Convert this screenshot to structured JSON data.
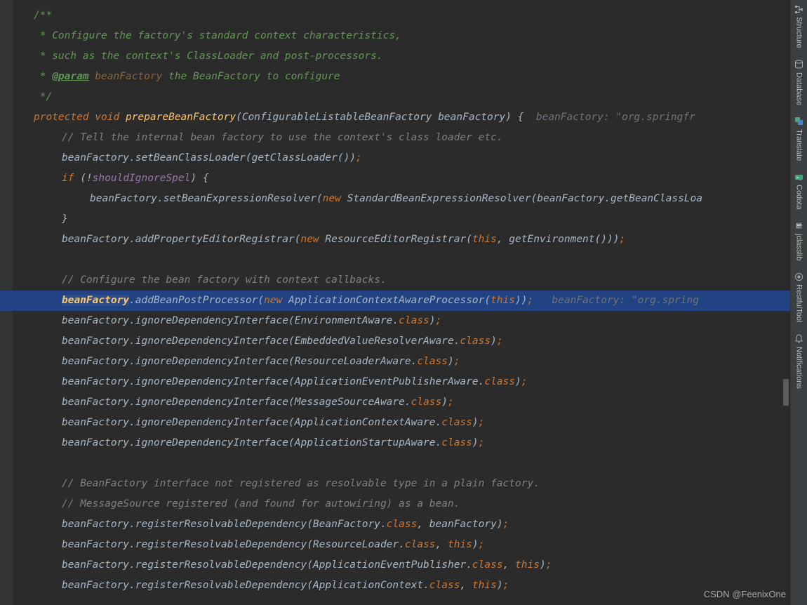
{
  "code": {
    "javadoc": {
      "l1": "/**",
      "l2": " * Configure the factory's standard context characteristics,",
      "l3": " * such as the context's ClassLoader and post-processors.",
      "l4_prefix": " * ",
      "l4_tag": "@param",
      "l4_param": " beanFactory",
      "l4_desc": " the BeanFactory to configure",
      "l5": " */"
    },
    "sig": {
      "protected": "protected",
      "void": " void ",
      "method": "prepareBeanFactory",
      "params": "(ConfigurableListableBeanFactory beanFactory) {",
      "hint": "  beanFactory: \"org.springfr"
    },
    "l7_comment": "// Tell the internal bean factory to use the context's class loader etc.",
    "l8": {
      "a": "beanFactory.setBeanClassLoader(getClassLoader())",
      "semi": ";"
    },
    "l9": {
      "if": "if",
      "open": " (!",
      "field": "shouldIgnoreSpel",
      "close": ") {"
    },
    "l10": {
      "a": "beanFactory.setBeanExpressionResolver(",
      "new": "new",
      "b": " StandardBeanExpressionResolver(beanFactory.getBeanClassLoa"
    },
    "l11": "}",
    "l12": {
      "a": "beanFactory.addPropertyEditorRegistrar(",
      "new": "new",
      "b": " ResourceEditorRegistrar(",
      "this": "this",
      "c": ", getEnvironment()))",
      "semi": ";"
    },
    "l14_comment": "// Configure the bean factory with context callbacks.",
    "l15": {
      "var": "beanFactory",
      "a": ".addBeanPostProcessor(",
      "new": "new",
      "b": " ApplicationContextAwareProcessor(",
      "this": "this",
      "c": "))",
      "semi": ";",
      "hint": "   beanFactory: \"org.spring"
    },
    "l16": {
      "a": "beanFactory.ignoreDependencyInterface(EnvironmentAware.",
      "class": "class",
      "b": ")",
      "semi": ";"
    },
    "l17": {
      "a": "beanFactory.ignoreDependencyInterface(EmbeddedValueResolverAware.",
      "class": "class",
      "b": ")",
      "semi": ";"
    },
    "l18": {
      "a": "beanFactory.ignoreDependencyInterface(ResourceLoaderAware.",
      "class": "class",
      "b": ")",
      "semi": ";"
    },
    "l19": {
      "a": "beanFactory.ignoreDependencyInterface(ApplicationEventPublisherAware.",
      "class": "class",
      "b": ")",
      "semi": ";"
    },
    "l20": {
      "a": "beanFactory.ignoreDependencyInterface(MessageSourceAware.",
      "class": "class",
      "b": ")",
      "semi": ";"
    },
    "l21": {
      "a": "beanFactory.ignoreDependencyInterface(ApplicationContextAware.",
      "class": "class",
      "b": ")",
      "semi": ";"
    },
    "l22": {
      "a": "beanFactory.ignoreDependencyInterface(ApplicationStartupAware.",
      "class": "class",
      "b": ")",
      "semi": ";"
    },
    "l24_comment": "// BeanFactory interface not registered as resolvable type in a plain factory.",
    "l25_comment": "// MessageSource registered (and found for autowiring) as a bean.",
    "l26": {
      "a": "beanFactory.registerResolvableDependency(BeanFactory.",
      "class": "class",
      "b": ", beanFactory)",
      "semi": ";"
    },
    "l27": {
      "a": "beanFactory.registerResolvableDependency(ResourceLoader.",
      "class": "class",
      "b": ", ",
      "this": "this",
      "c": ")",
      "semi": ";"
    },
    "l28": {
      "a": "beanFactory.registerResolvableDependency(ApplicationEventPublisher.",
      "class": "class",
      "b": ", ",
      "this": "this",
      "c": ")",
      "semi": ";"
    },
    "l29": {
      "a": "beanFactory.registerResolvableDependency(ApplicationContext.",
      "class": "class",
      "b": ", ",
      "this": "this",
      "c": ")",
      "semi": ";"
    }
  },
  "tools": [
    {
      "label": "Structure",
      "icon": "structure"
    },
    {
      "label": "Database",
      "icon": "database"
    },
    {
      "label": "Translate",
      "icon": "translate"
    },
    {
      "label": "Codota",
      "icon": "codota"
    },
    {
      "label": "jclasslib",
      "icon": "jclasslib"
    },
    {
      "label": "RestfulTool",
      "icon": "restful"
    },
    {
      "label": "Notifications",
      "icon": "bell"
    }
  ],
  "watermark": "CSDN @FeenixOne"
}
